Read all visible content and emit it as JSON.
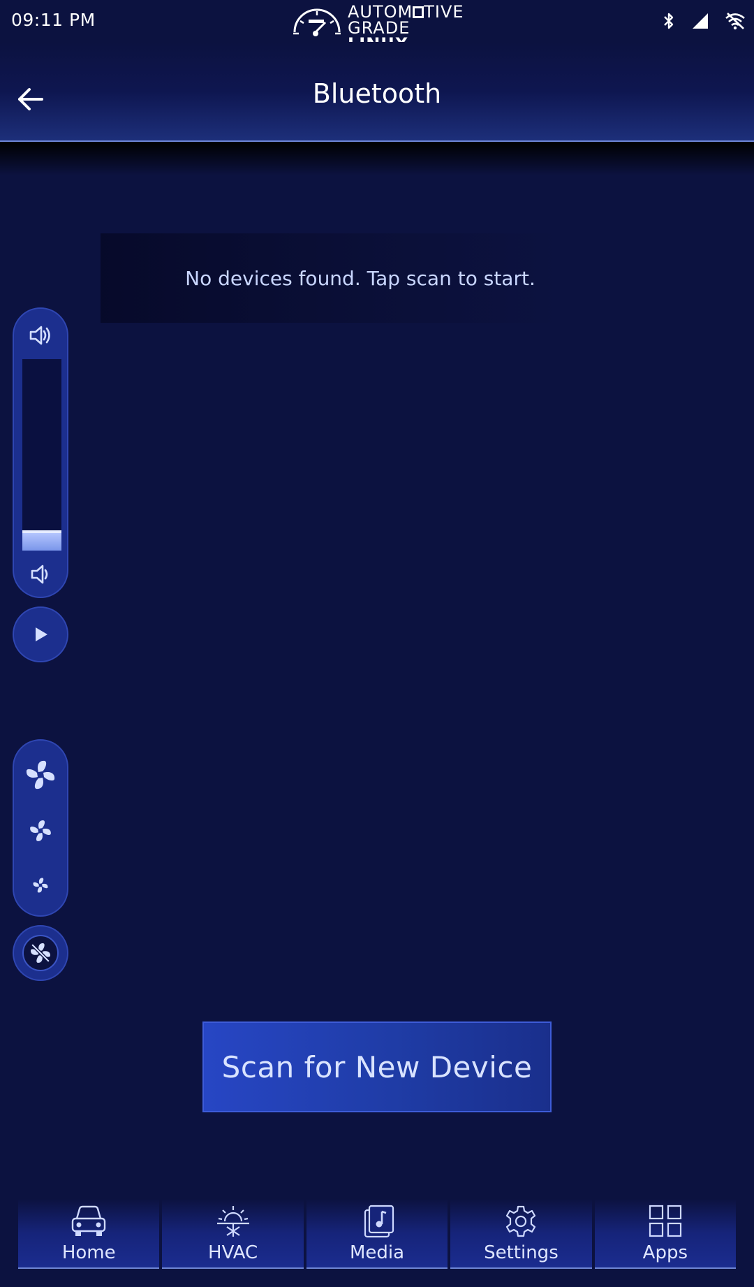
{
  "status_bar": {
    "time": "09:11 PM",
    "logo_line1_prefix": "AUTOM",
    "logo_line1_suffix": "TIVE",
    "logo_line2_prefix": "GRADE ",
    "logo_line2_bold": "LINUX",
    "icons": [
      "bluetooth-icon",
      "cellular-signal-icon",
      "wifi-off-icon"
    ]
  },
  "header": {
    "title": "Bluetooth",
    "back_icon": "arrow-left-icon"
  },
  "devices": {
    "empty_message": "No devices found. Tap scan to start."
  },
  "volume": {
    "level_percent": 10,
    "up_icon": "volume-up-icon",
    "down_icon": "volume-down-icon"
  },
  "media": {
    "play_icon": "play-icon"
  },
  "fan": {
    "speeds": [
      "fan-high-icon",
      "fan-medium-icon",
      "fan-low-icon"
    ],
    "off_icon": "fan-off-icon"
  },
  "scan_button": {
    "label": "Scan for New Device"
  },
  "bottom_nav": {
    "items": [
      {
        "label": "Home",
        "icon": "car-icon"
      },
      {
        "label": "HVAC",
        "icon": "hvac-icon"
      },
      {
        "label": "Media",
        "icon": "music-note-icon"
      },
      {
        "label": "Settings",
        "icon": "gear-icon"
      },
      {
        "label": "Apps",
        "icon": "grid-icon"
      }
    ]
  },
  "colors": {
    "background": "#0c1240",
    "accent": "#1c2f8e",
    "button": "#2746c4",
    "text_light": "#c9d6ff"
  }
}
